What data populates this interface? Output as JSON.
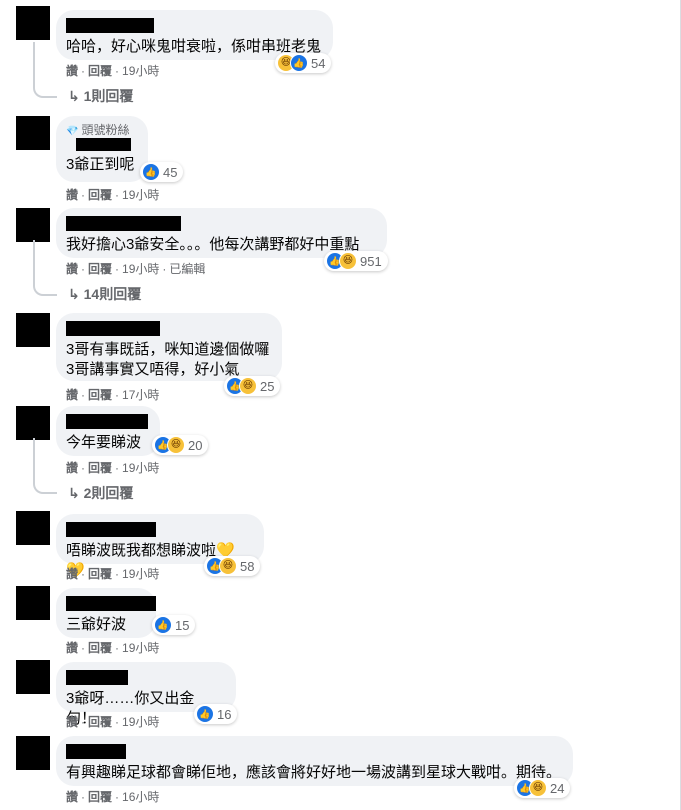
{
  "actions": {
    "like": "讚",
    "reply": "回覆",
    "dot": "·"
  },
  "comments": [
    {
      "badge": "",
      "text": "哈哈，好心咪鬼咁衰啦，係咁串班老鬼",
      "reaction_count": "54",
      "icons": [
        "haha",
        "like"
      ],
      "time": "19小時",
      "edited": "",
      "replies": "1則回覆"
    },
    {
      "badge": "頭號粉絲",
      "text": "3爺正到呢",
      "reaction_count": "45",
      "icons": [
        "like"
      ],
      "time": "19小時",
      "edited": "",
      "replies": ""
    },
    {
      "badge": "",
      "text": "我好擔心3爺安全。。。他每次講野都好中重點",
      "reaction_count": "951",
      "icons": [
        "like",
        "haha"
      ],
      "time": "19小時",
      "edited": "已編輯",
      "replies": "14則回覆"
    },
    {
      "badge": "",
      "text": "3哥有事既話，咪知道邊個做囉\n3哥講事實又唔得，好小氣",
      "reaction_count": "25",
      "icons": [
        "like",
        "haha"
      ],
      "time": "17小時",
      "edited": "",
      "replies": ""
    },
    {
      "badge": "",
      "text": "今年要睇波",
      "reaction_count": "20",
      "icons": [
        "like",
        "haha"
      ],
      "time": "19小時",
      "edited": "",
      "replies": "2則回覆"
    },
    {
      "badge": "",
      "text": "唔睇波既我都想睇波啦💛💛",
      "reaction_count": "58",
      "icons": [
        "like",
        "haha"
      ],
      "time": "19小時",
      "edited": "",
      "replies": ""
    },
    {
      "badge": "",
      "text": "三爺好波",
      "reaction_count": "15",
      "icons": [
        "like"
      ],
      "time": "19小時",
      "edited": "",
      "replies": ""
    },
    {
      "badge": "",
      "text": "3爺呀……你又出金句！",
      "reaction_count": "16",
      "icons": [
        "like"
      ],
      "time": "19小時",
      "edited": "",
      "replies": ""
    },
    {
      "badge": "",
      "text": "有興趣睇足球都會睇佢地，應該會將好好地一場波講到星球大戰咁。期待。",
      "reaction_count": "24",
      "icons": [
        "like",
        "haha"
      ],
      "time": "16小時",
      "edited": "",
      "replies": ""
    }
  ],
  "colors": {
    "bubble": "#f0f2f5",
    "like": "#1b74e4",
    "haha": "#f7c139",
    "muted": "#65676b"
  }
}
